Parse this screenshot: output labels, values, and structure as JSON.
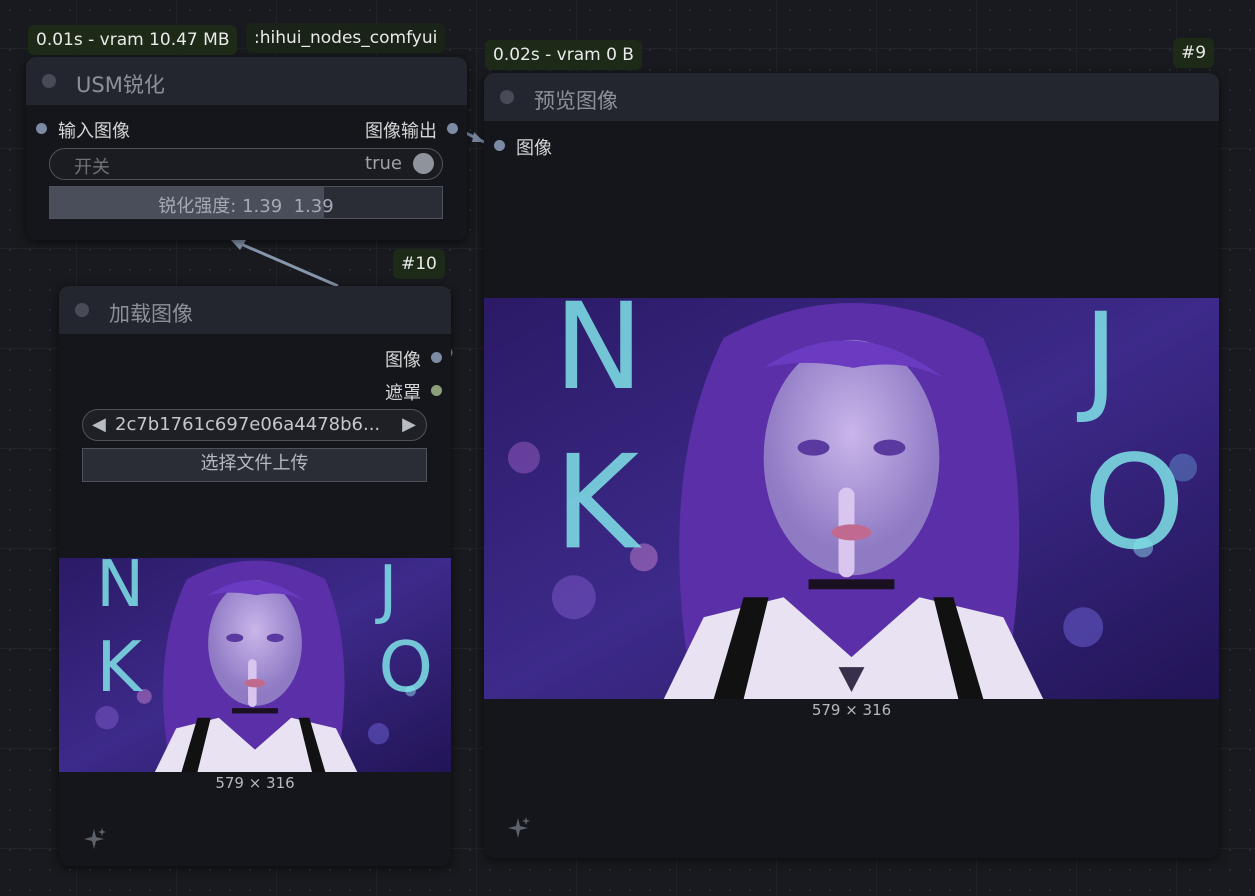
{
  "links": {
    "output_to_preview_color": "#7c8aa2",
    "load_to_usm_color": "#8796ad"
  },
  "badges": {
    "usm_timing": "0.01s - vram 10.47 MB",
    "usm_pack": ":hihui_nodes_comfyui",
    "preview_timing": "0.02s - vram 0 B",
    "preview_id": "#9",
    "load_id": "#10"
  },
  "usm_node": {
    "title": "USM锐化",
    "input_label": "输入图像",
    "output_label": "图像输出",
    "toggle": {
      "label": "开关",
      "value": "true"
    },
    "slider": {
      "label": "锐化强度: 1.39  1.39",
      "fill_fraction": 0.7
    }
  },
  "load_node": {
    "title": "加载图像",
    "output_image_label": "图像",
    "output_mask_label": "遮罩",
    "output_mask_color": "#8c9e7c",
    "file_value": "2c7b1761c697e06a4478b6...",
    "prev_arrow": "◀",
    "next_arrow": "▶",
    "upload_label": "选择文件上传",
    "image_size": "579 × 316"
  },
  "preview_node": {
    "title": "预览图像",
    "input_label": "图像",
    "image_size": "579 × 316"
  },
  "image": {
    "description_icon": "neon-portrait-image",
    "letters": [
      "N",
      "K",
      "J",
      "O"
    ],
    "neon_color": "#7fe3e8",
    "hair_color": "#5a2fa8",
    "background_color": "#2b1a66"
  },
  "icons": {
    "sparkle": "sparkle-icon"
  }
}
